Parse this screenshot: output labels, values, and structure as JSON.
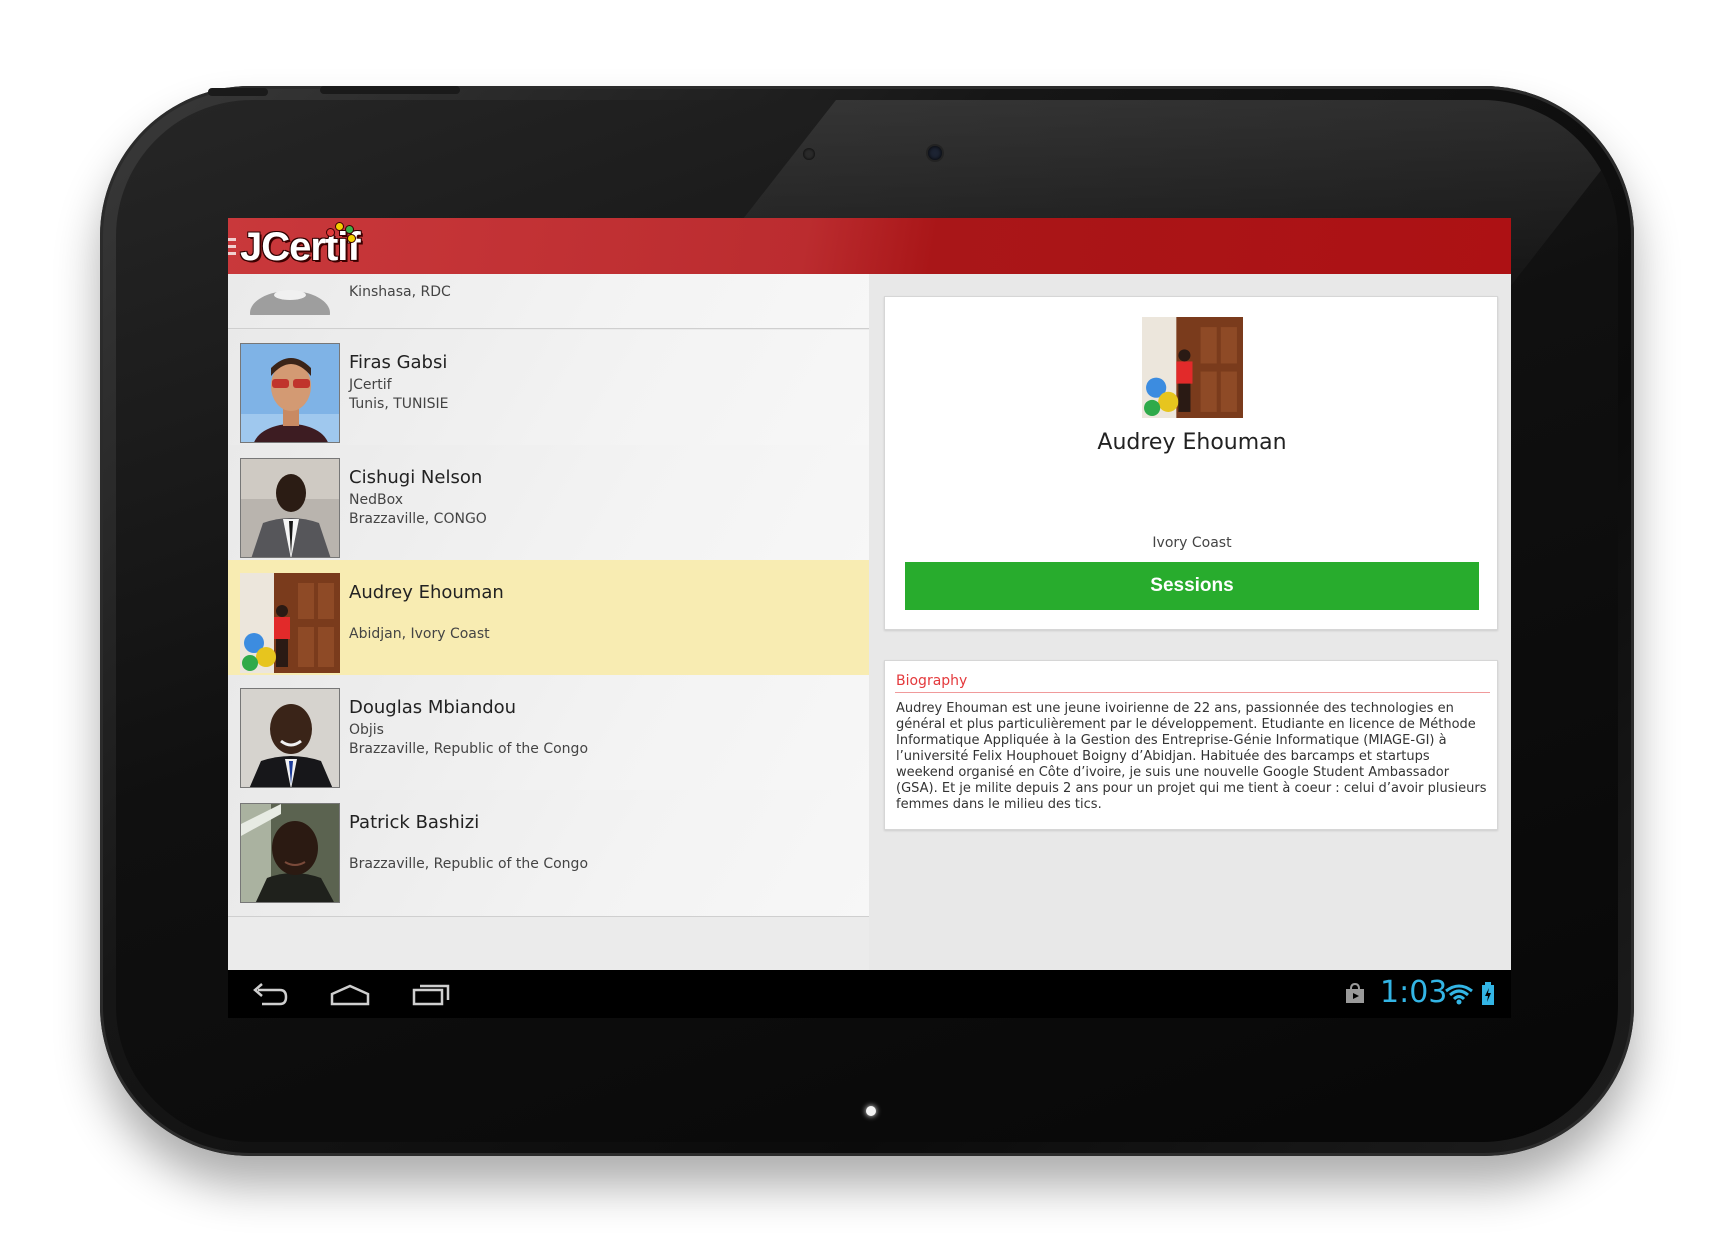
{
  "app": {
    "logo_text": "JCertif",
    "accent_color": "#b31b1e",
    "selected_row_color": "#f8ecb2",
    "sessions_button_color": "#28ac2d"
  },
  "speakers": [
    {
      "name": "",
      "company": "",
      "location": "Kinshasa, RDC"
    },
    {
      "name": "Firas Gabsi",
      "company": "JCertif",
      "location": "Tunis, TUNISIE"
    },
    {
      "name": "Cishugi Nelson",
      "company": "NedBox",
      "location": "Brazzaville, CONGO"
    },
    {
      "name": "Audrey Ehouman",
      "company": "",
      "location": "Abidjan, Ivory Coast",
      "selected": true
    },
    {
      "name": "Douglas Mbiandou",
      "company": "Objis",
      "location": "Brazzaville, Republic of the Congo"
    },
    {
      "name": "Patrick Bashizi",
      "company": "",
      "location": "Brazzaville, Republic of the Congo"
    }
  ],
  "detail": {
    "name": "Audrey Ehouman",
    "location": "Ivory Coast",
    "sessions_label": "Sessions",
    "biography_title": "Biography",
    "biography_text": "Audrey Ehouman est une jeune ivoirienne de 22 ans, passionnée des technologies en général et plus particulièrement par le développement. Etudiante en licence de Méthode Informatique Appliquée à la Gestion des Entreprise-Génie Informatique (MIAGE-GI) à l’université Felix Houphouet Boigny d’Abidjan. Habituée des barcamps et startups weekend organisé en Côte d’ivoire, je suis une nouvelle Google Student Ambassador (GSA). Et je milite depuis 2 ans pour un projet qui me tient à coeur : celui d’avoir plusieurs femmes dans le milieu des tics."
  },
  "status_bar": {
    "time": "1:03",
    "icons": [
      "back-icon",
      "home-icon",
      "recents-icon",
      "play-store-icon",
      "wifi-icon",
      "battery-icon"
    ]
  }
}
